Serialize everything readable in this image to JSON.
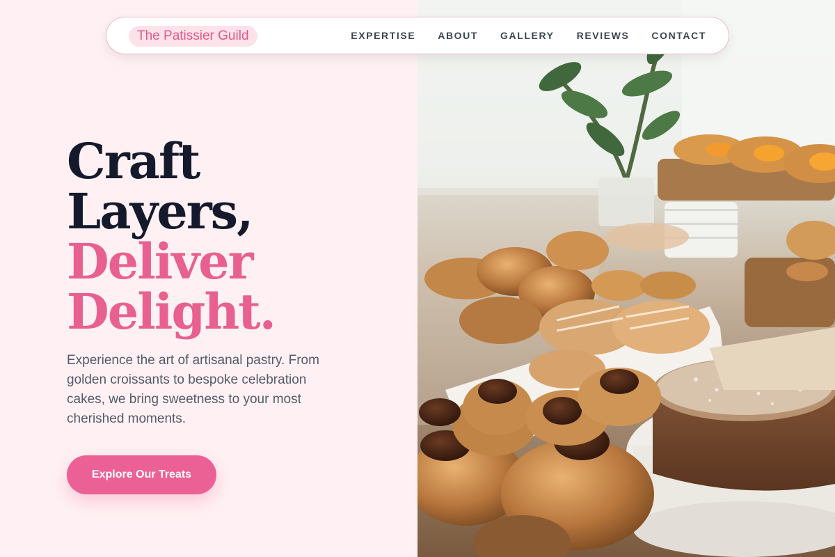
{
  "nav": {
    "brand": "The Patissier Guild",
    "links": [
      "EXPERTISE",
      "ABOUT",
      "GALLERY",
      "REVIEWS",
      "CONTACT"
    ]
  },
  "hero": {
    "title_line1": "Craft",
    "title_line2": "Layers,",
    "title_line3": "Deliver",
    "title_line4": "Delight.",
    "description": "Experience the art of artisanal pastry. From golden croissants to bespoke celebration cakes, we bring sweetness to your most cherished moments.",
    "cta_label": "Explore Our Treats"
  },
  "colors": {
    "accent": "#ec6195",
    "title_dark": "#141a2c",
    "background": "#fff1f3"
  }
}
